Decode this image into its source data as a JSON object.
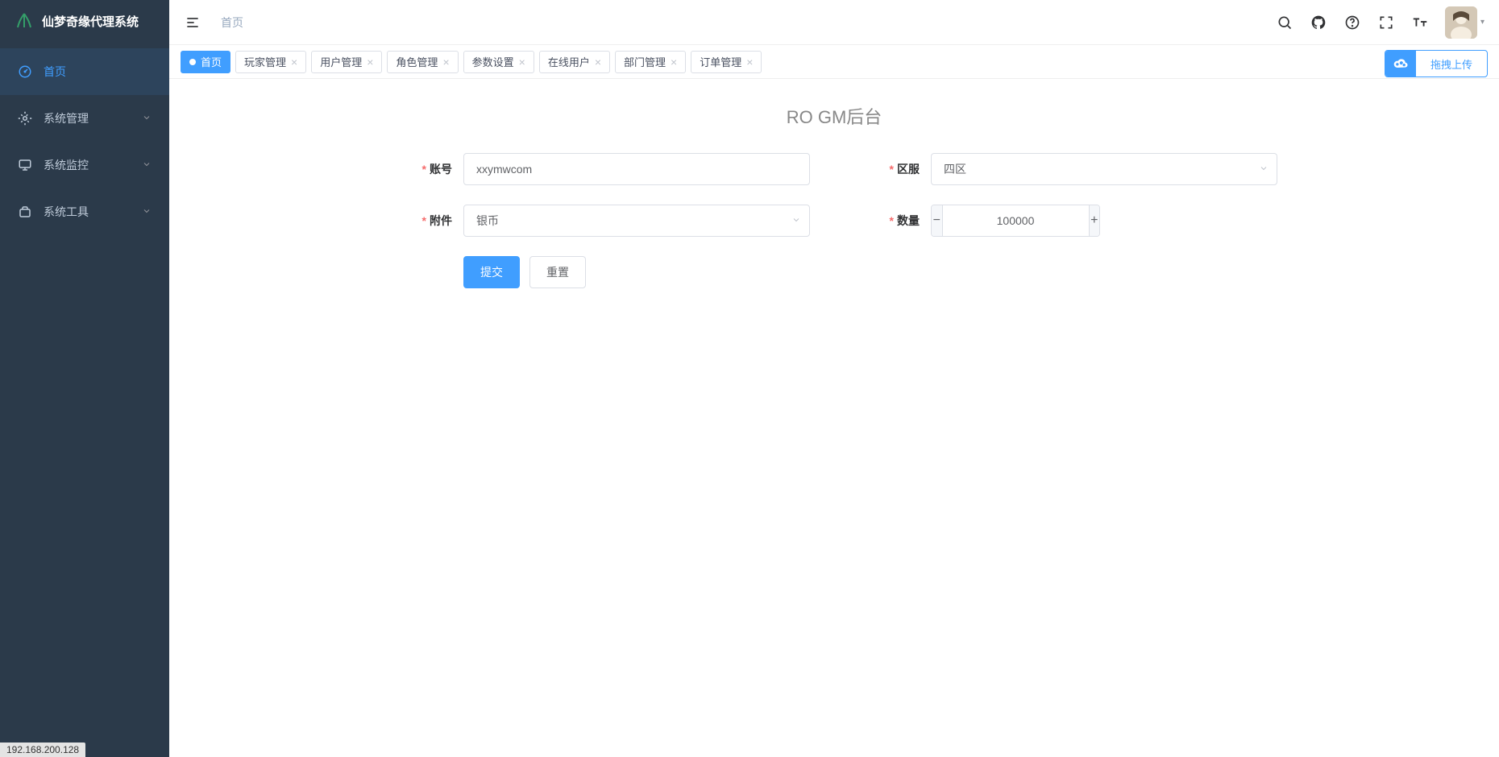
{
  "app_title": "仙梦奇缘代理系统",
  "sidebar": {
    "items": [
      {
        "label": "首页",
        "icon": "dashboard",
        "active": true,
        "expandable": false
      },
      {
        "label": "系统管理",
        "icon": "gear",
        "active": false,
        "expandable": true
      },
      {
        "label": "系统监控",
        "icon": "monitor",
        "active": false,
        "expandable": true
      },
      {
        "label": "系统工具",
        "icon": "toolbox",
        "active": false,
        "expandable": true
      }
    ]
  },
  "header": {
    "breadcrumb": "首页"
  },
  "tabs": [
    {
      "label": "首页",
      "closable": false,
      "active": true
    },
    {
      "label": "玩家管理",
      "closable": true,
      "active": false
    },
    {
      "label": "用户管理",
      "closable": true,
      "active": false
    },
    {
      "label": "角色管理",
      "closable": true,
      "active": false
    },
    {
      "label": "参数设置",
      "closable": true,
      "active": false
    },
    {
      "label": "在线用户",
      "closable": true,
      "active": false
    },
    {
      "label": "部门管理",
      "closable": true,
      "active": false
    },
    {
      "label": "订单管理",
      "closable": true,
      "active": false
    }
  ],
  "upload_btn": "拖拽上传",
  "page": {
    "title": "RO GM后台",
    "form": {
      "account_label": "账号",
      "account_value": "xxymwcom",
      "zone_label": "区服",
      "zone_value": "四区",
      "attachment_label": "附件",
      "attachment_value": "银币",
      "quantity_label": "数量",
      "quantity_value": "100000",
      "submit": "提交",
      "reset": "重置"
    }
  },
  "status_bar": "192.168.200.128"
}
